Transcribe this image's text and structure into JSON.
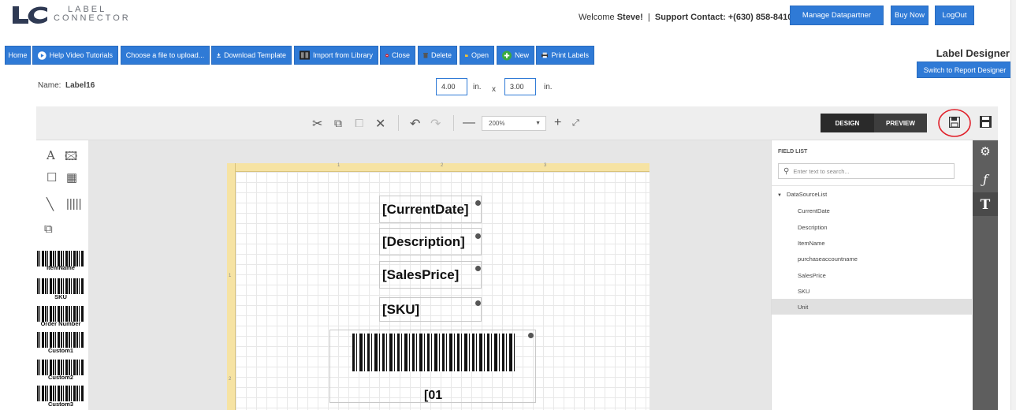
{
  "header": {
    "logo_text": "LABEL\nCONNECTOR",
    "welcome_prefix": "Welcome",
    "user_name": "Steve!",
    "separator": "|",
    "support_label": "Support Contact: +(630) 858-8410",
    "manage_btn": "Manage Datapartner",
    "buy_btn": "Buy Now",
    "logout_btn": "LogOut"
  },
  "toolbar": {
    "home": "Home",
    "help": "Help Video Tutorials",
    "choose_file": "Choose a file to upload...",
    "download": "Download Template",
    "import": "Import from Library",
    "close": "Close",
    "delete": "Delete",
    "open": "Open",
    "new": "New",
    "print": "Print Labels"
  },
  "designer_title": "Label Designer",
  "switch_btn": "Switch to Report Designer",
  "label_info": {
    "name_label": "Name:",
    "name_value": "Label16",
    "width": "4.00",
    "height": "3.00",
    "unit": "in.",
    "times": "x"
  },
  "design_bar": {
    "zoom": "200%",
    "design_tab": "DESIGN",
    "preview_tab": "PREVIEW"
  },
  "toolbox": {
    "barcodes": [
      "ItemName",
      "SKU",
      "Order Number",
      "Custom1",
      "Custom2",
      "Custom3"
    ]
  },
  "canvas": {
    "ruler_ticks": [
      "1",
      "2",
      "3"
    ],
    "ruler_left_ticks": [
      "1",
      "2"
    ],
    "fields": [
      "[CurrentDate]",
      "[Description]",
      "[SalesPrice]",
      "[SKU]"
    ],
    "barcode_text": "[01"
  },
  "field_list": {
    "title": "FIELD LIST",
    "search_placeholder": "Enter text to search...",
    "root": "DataSourceList",
    "items": [
      "CurrentDate",
      "Description",
      "ItemName",
      "purchaseaccountname",
      "SalesPrice",
      "SKU",
      "Unit"
    ],
    "selected": "Unit"
  },
  "colors": {
    "accent": "#2f7ad6",
    "ruler": "#f6e3a3",
    "dark_strip": "#5e5e5e",
    "highlight_circle": "#e0202a"
  }
}
